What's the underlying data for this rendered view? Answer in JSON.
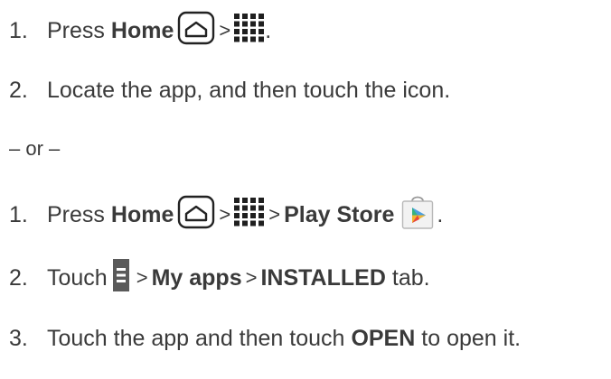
{
  "steps_a": [
    {
      "num": "1.",
      "press": "Press",
      "home": "Home",
      "gt": ">",
      "period": "."
    },
    {
      "num": "2.",
      "text": "Locate the app, and then touch the icon."
    }
  ],
  "or_text": "– or –",
  "steps_b": [
    {
      "num": "1.",
      "press": "Press",
      "home": "Home",
      "gt1": ">",
      "gt2": ">",
      "play_store": "Play Store",
      "period": "."
    },
    {
      "num": "2.",
      "touch": "Touch",
      "gt1": ">",
      "my_apps": "My apps",
      "gt2": ">",
      "installed": "INSTALLED",
      "tab": "tab."
    },
    {
      "num": "3.",
      "pre": "Touch the app and then touch",
      "open": "OPEN",
      "post": "to open it."
    }
  ],
  "icons": {
    "home": "home-key-icon",
    "apps": "apps-grid-icon",
    "store": "play-store-icon",
    "menu": "menu-icon"
  }
}
